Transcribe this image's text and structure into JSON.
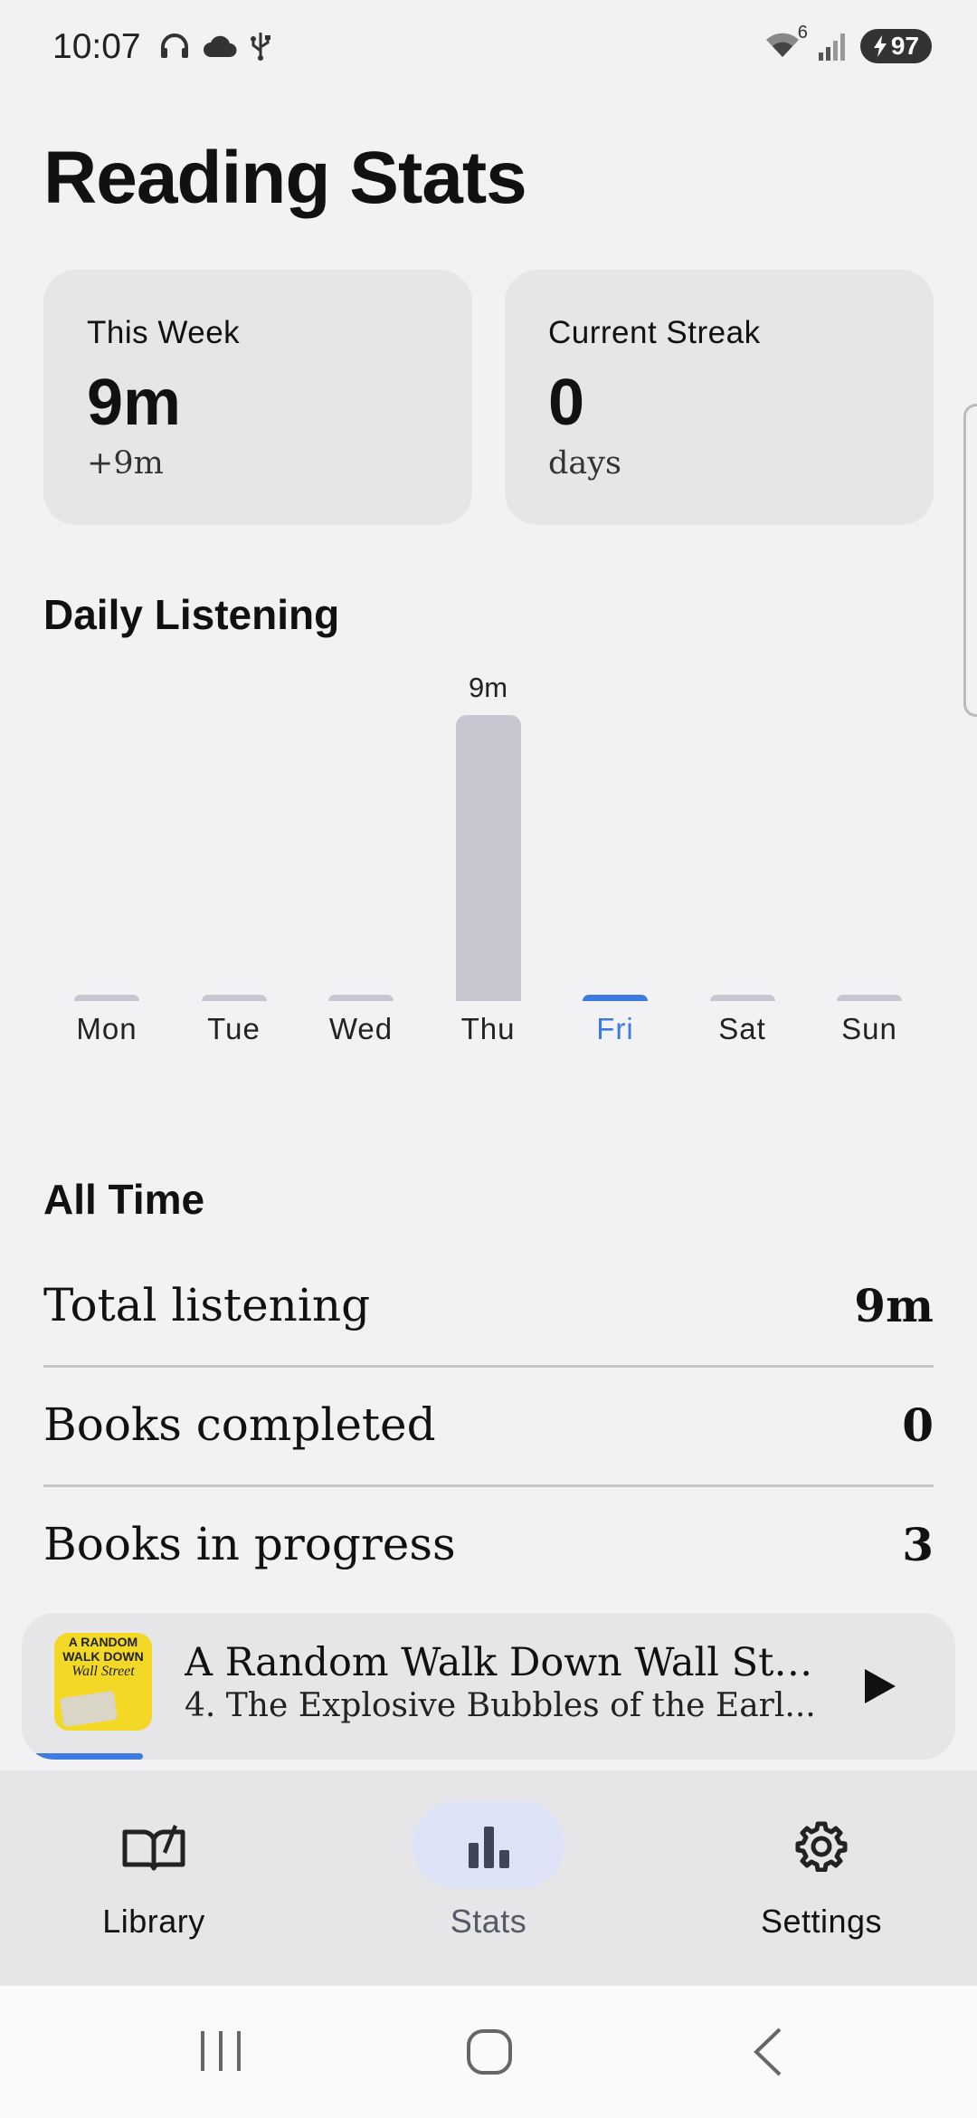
{
  "status_bar": {
    "time": "10:07",
    "wifi_badge": "6",
    "battery": "97"
  },
  "page_title": "Reading Stats",
  "cards": [
    {
      "label": "This Week",
      "value": "9m",
      "sub": "+9m"
    },
    {
      "label": "Current Streak",
      "value": "0",
      "sub": "days"
    }
  ],
  "daily_section_title": "Daily Listening",
  "chart_data": {
    "type": "bar",
    "categories": [
      "Mon",
      "Tue",
      "Wed",
      "Thu",
      "Fri",
      "Sat",
      "Sun"
    ],
    "values": [
      0,
      0,
      0,
      9,
      0,
      0,
      0
    ],
    "unit": "m",
    "value_labels": [
      "",
      "",
      "",
      "9m",
      "",
      "",
      ""
    ],
    "highlighted_category": "Fri",
    "colors": {
      "bar": "#c6c7d0",
      "highlight": "#3d7be0"
    }
  },
  "all_time_section_title": "All Time",
  "all_time": [
    {
      "label": "Total listening",
      "value": "9m"
    },
    {
      "label": "Books completed",
      "value": "0"
    },
    {
      "label": "Books in progress",
      "value": "3"
    }
  ],
  "player": {
    "title": "A Random Walk Down Wall Str...",
    "chapter": "4. The Explosive Bubbles of the Earl...",
    "cover_lines": [
      "A RANDOM",
      "WALK DOWN",
      "Wall Street"
    ],
    "progress": 0.12
  },
  "nav": [
    {
      "label": "Library",
      "icon": "book-open-icon",
      "active": false
    },
    {
      "label": "Stats",
      "icon": "bar-chart-icon",
      "active": true
    },
    {
      "label": "Settings",
      "icon": "gear-icon",
      "active": false
    }
  ],
  "colors": {
    "accent": "#3d7be0",
    "background": "#f2f2f5",
    "card": "#e6e6e9"
  }
}
